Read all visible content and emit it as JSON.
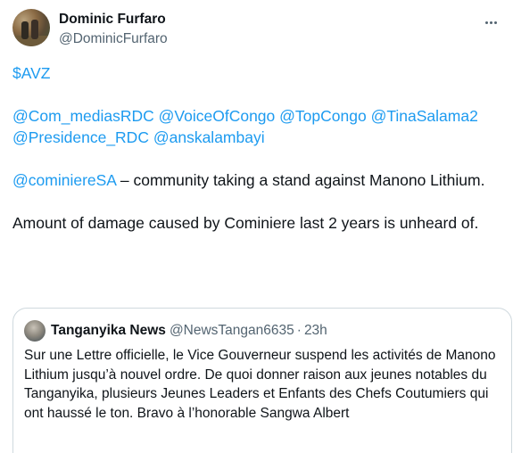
{
  "tweet": {
    "author_name": "Dominic Furfaro",
    "author_handle": "@DominicFurfaro",
    "body": {
      "line1": "$AVZ",
      "mentions_line1": [
        "@Com_mediasRDC",
        "@VoiceOfCongo",
        "@TopCongo",
        "@TinaSalama2"
      ],
      "mentions_line2": [
        "@Presidence_RDC",
        "@anskalambayi"
      ],
      "para3_mention": "@cominiereSA",
      "para3_text": " – community taking a stand against Manono Lithium.",
      "para4": "Amount of damage caused by Cominiere last 2 years is unheard of."
    }
  },
  "quote": {
    "author_name": "Tanganyika News",
    "author_handle": "@NewsTangan6635",
    "separator": "·",
    "time": "23h",
    "text": "Sur une Lettre officielle, le Vice Gouverneur suspend les activités de Manono Lithium jusqu’à nouvel ordre. De quoi donner raison aux jeunes notables du Tanganyika, plusieurs Jeunes Leaders et Enfants des Chefs Coutumiers qui ont haussé le ton. Bravo à l’honorable Sangwa Albert"
  },
  "colors": {
    "link": "#1d9bf0",
    "secondary_text": "#536471",
    "border": "#cfd9de"
  },
  "icons": {
    "more": "more-horizontal-icon"
  }
}
